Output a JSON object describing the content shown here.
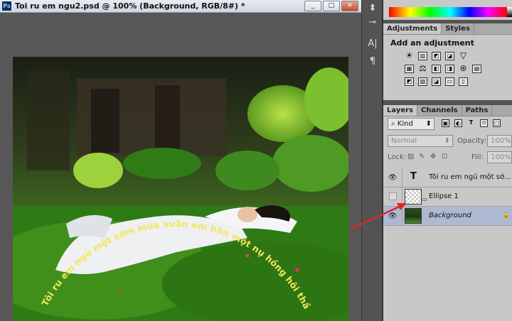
{
  "document": {
    "app_icon_label": "Ps",
    "title": "Toi ru em ngu2.psd @ 100% (Background, RGB/8#) *",
    "window_buttons": [
      "_",
      "□",
      "✕"
    ]
  },
  "curved_text": "Tôi ru em ngủ một sớm mùa xuân em hôn một nụ hồng hôi thầm vê giọt nắng Tôi ru em ngủ Hạ cũng vừa sang em hôn lên tay mình để chưa xót tình trần...",
  "colors": {
    "curved_text": "#f2e75a",
    "arrow": "#e0262a",
    "selected_layer": "#aeb9d1"
  },
  "adjustments": {
    "tabs": [
      "Adjustments",
      "Styles"
    ],
    "heading": "Add an adjustment",
    "icons": [
      [
        "brightness-contrast",
        "levels",
        "curves",
        "exposure",
        "black-triangle"
      ],
      [
        "vibrance",
        "balance",
        "hue-saturation",
        "black-white",
        "photo-filter",
        "channel-mixer"
      ],
      [
        "invert",
        "posterize",
        "threshold",
        "gradient-map",
        "selective-color"
      ]
    ]
  },
  "layers_panel": {
    "tabs": [
      "Layers",
      "Channels",
      "Paths"
    ],
    "filter_kind": "Kind",
    "blend_mode": "Normal",
    "opacity_label": "Opacity:",
    "opacity_value": "100%",
    "lock_label": "Lock:",
    "fill_label": "Fill:",
    "fill_value": "100%",
    "layers": [
      {
        "name": "Tôi ru em ngủ một sớ...",
        "type": "text",
        "visible": true
      },
      {
        "name": "Ellipse 1",
        "type": "shape",
        "visible": false
      },
      {
        "name": "Background",
        "type": "image",
        "visible": true,
        "locked": true
      }
    ]
  }
}
